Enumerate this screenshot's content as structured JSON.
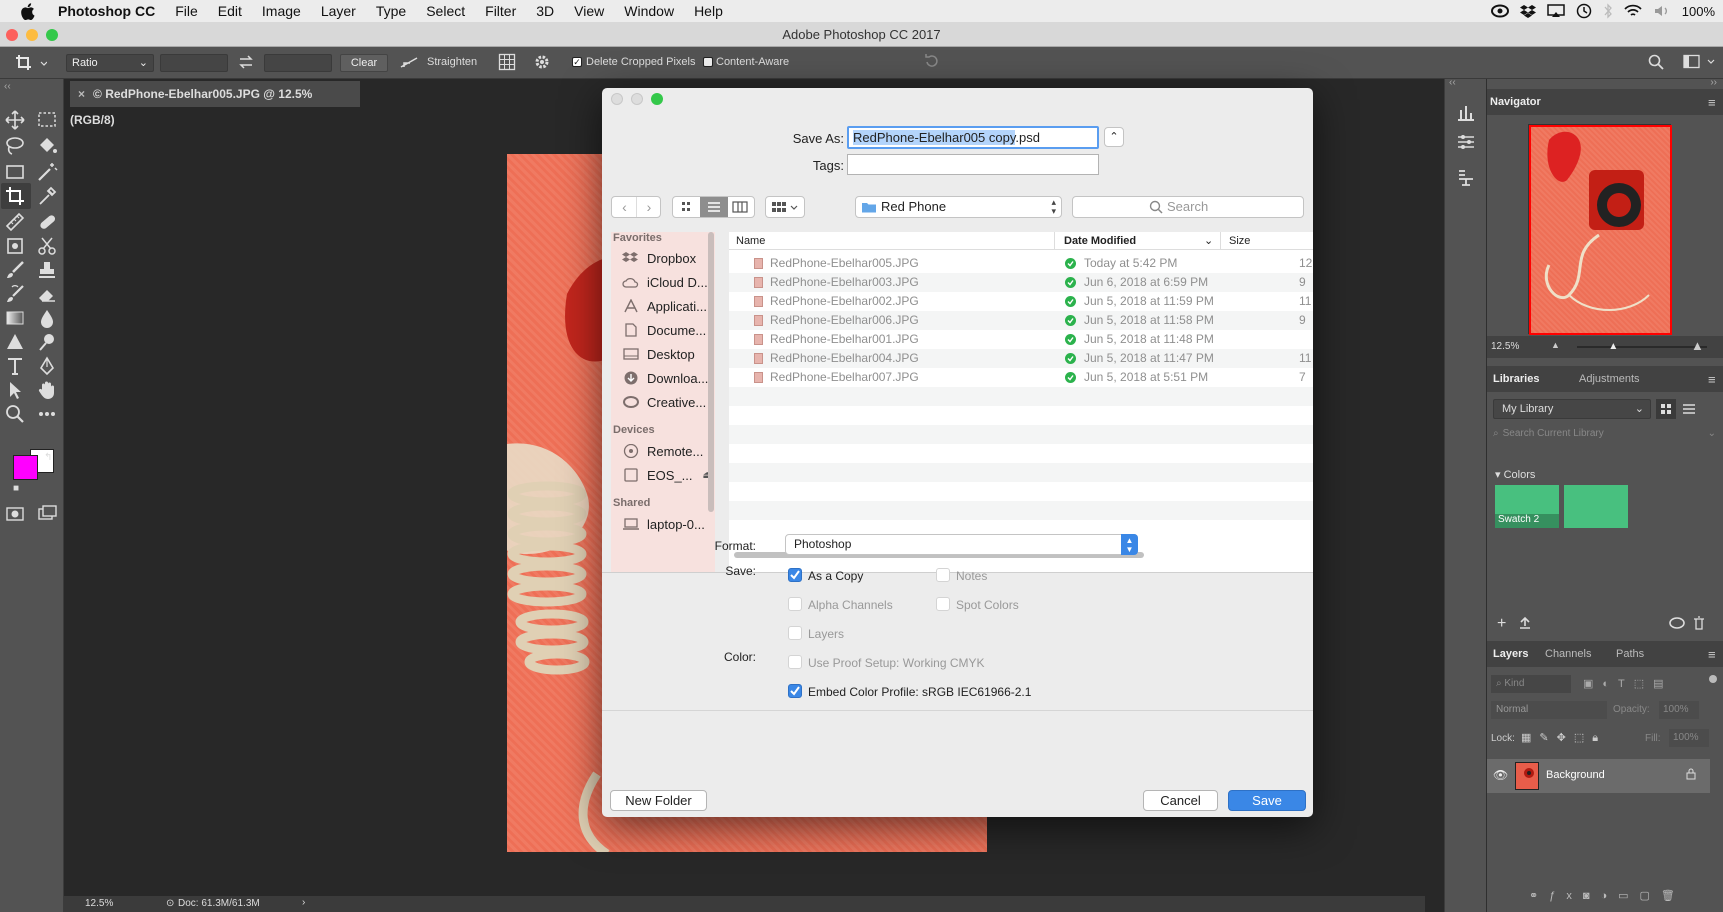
{
  "menubar": {
    "app": "Photoshop CC",
    "items": [
      "File",
      "Edit",
      "Image",
      "Layer",
      "Type",
      "Select",
      "Filter",
      "3D",
      "View",
      "Window",
      "Help"
    ],
    "battery": "100%"
  },
  "window": {
    "title": "Adobe Photoshop CC 2017"
  },
  "options": {
    "ratio": "Ratio",
    "clear": "Clear",
    "straighten": "Straighten",
    "delete_cropped": "Delete Cropped Pixels",
    "content_aware": "Content-Aware",
    "delete_cropped_checked": true,
    "content_aware_checked": false
  },
  "document": {
    "tab_title": "© RedPhone-Ebelhar005.JPG @ 12.5% (RGB/8)",
    "zoom": "12.5%",
    "doc_size": "Doc: 61.3M/61.3M"
  },
  "colors": {
    "foreground": "#ff00ff",
    "background": "#ffffff",
    "accent": "#3a87e6"
  },
  "navigator": {
    "title": "Navigator",
    "zoom": "12.5%",
    "zoom_level": 0.28
  },
  "libraries": {
    "tabs": [
      "Libraries",
      "Adjustments"
    ],
    "library": "My Library",
    "search_placeholder": "Search Current Library",
    "colors_section": "Colors",
    "swatches": [
      {
        "label": "Swatch 2",
        "color": "#48c07f"
      },
      {
        "label": "",
        "color": "#48c07f"
      }
    ]
  },
  "layers": {
    "tabs": [
      "Layers",
      "Channels",
      "Paths"
    ],
    "kind": "Kind",
    "blend": "Normal",
    "opacity_label": "Opacity:",
    "opacity": "100%",
    "lock_label": "Lock:",
    "fill_label": "Fill:",
    "fill": "100%",
    "layer_name": "Background"
  },
  "dialog": {
    "save_as_label": "Save As:",
    "save_as_selected": "RedPhone-Ebelhar005 copy",
    "save_as_ext": ".psd",
    "tags_label": "Tags:",
    "location": "Red Phone",
    "search_placeholder": "Search",
    "sidebar": {
      "favorites_header": "Favorites",
      "favorites": [
        "Dropbox",
        "iCloud D...",
        "Applicati...",
        "Docume...",
        "Desktop",
        "Downloa...",
        "Creative..."
      ],
      "devices_header": "Devices",
      "devices": [
        "Remote...",
        "EOS_..."
      ],
      "shared_header": "Shared",
      "shared": [
        "laptop-0..."
      ]
    },
    "columns": {
      "name": "Name",
      "date": "Date Modified",
      "size": "Size"
    },
    "files": [
      {
        "name": "RedPhone-Ebelhar005.JPG",
        "date": "Today at 5:42 PM",
        "size": "12"
      },
      {
        "name": "RedPhone-Ebelhar003.JPG",
        "date": "Jun 6, 2018 at 6:59 PM",
        "size": "9"
      },
      {
        "name": "RedPhone-Ebelhar002.JPG",
        "date": "Jun 5, 2018 at 11:59 PM",
        "size": "11"
      },
      {
        "name": "RedPhone-Ebelhar006.JPG",
        "date": "Jun 5, 2018 at 11:58 PM",
        "size": "9"
      },
      {
        "name": "RedPhone-Ebelhar001.JPG",
        "date": "Jun 5, 2018 at 11:48 PM",
        "size": ""
      },
      {
        "name": "RedPhone-Ebelhar004.JPG",
        "date": "Jun 5, 2018 at 11:47 PM",
        "size": "11"
      },
      {
        "name": "RedPhone-Ebelhar007.JPG",
        "date": "Jun 5, 2018 at 5:51 PM",
        "size": "7"
      }
    ],
    "format_label": "Format:",
    "format": "Photoshop",
    "save_label": "Save:",
    "opt_as_copy": "As a Copy",
    "opt_notes": "Notes",
    "opt_alpha": "Alpha Channels",
    "opt_spot": "Spot Colors",
    "opt_layers": "Layers",
    "color_label": "Color:",
    "opt_proof": "Use Proof Setup:  Working CMYK",
    "opt_embed": "Embed Color Profile:  sRGB IEC61966-2.1",
    "new_folder": "New Folder",
    "cancel": "Cancel",
    "save": "Save"
  }
}
